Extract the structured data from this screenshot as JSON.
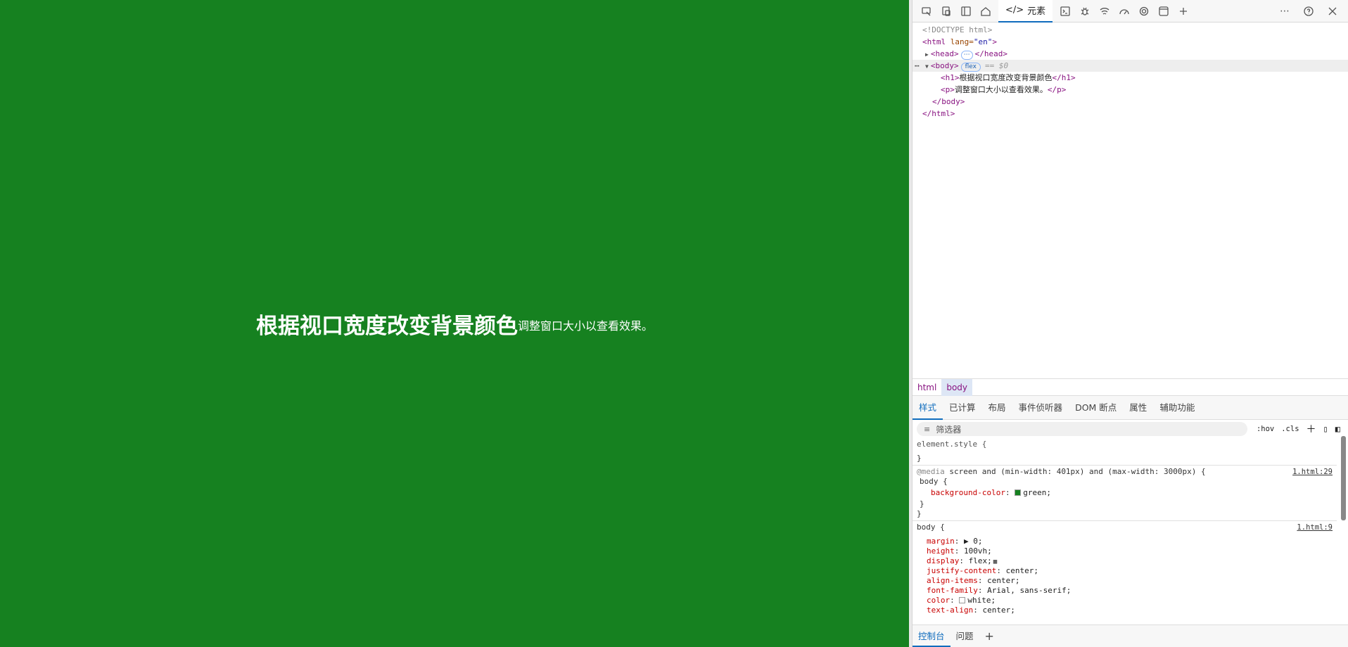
{
  "page": {
    "heading": "根据视口宽度改变背景颜色",
    "paragraph": "调整窗口大小以查看效果。",
    "background": "#168120"
  },
  "devtools": {
    "toolbar": {
      "active_tab": "元素",
      "active_tab_icon": "</>",
      "icons": [
        "inspect-icon",
        "device-icon",
        "dock-icon",
        "home-icon",
        "console-icon",
        "bug-icon",
        "network-icon",
        "performance-icon",
        "settings-gear-icon",
        "application-icon",
        "add-icon"
      ],
      "right_icons": [
        "more-icon",
        "help-icon",
        "close-icon"
      ]
    },
    "dom": {
      "doctype": "<!DOCTYPE html>",
      "html_open": "<html",
      "html_attr": " lang=",
      "html_attr_val": "\"en\"",
      "html_close_bracket": ">",
      "head_open": "<head>",
      "head_ellipsis": "⋯",
      "head_close": "</head>",
      "body_open": "<body>",
      "body_badge": "flex",
      "body_eq": "== $0",
      "h1_open": "<h1>",
      "h1_text": "根据视口宽度改变背景颜色",
      "h1_close": "</h1>",
      "p_open": "<p>",
      "p_text": "调整窗口大小以查看效果。",
      "p_close": "</p>",
      "body_close": "</body>",
      "html_close": "</html>"
    },
    "breadcrumbs": [
      "html",
      "body"
    ],
    "subtabs": [
      "样式",
      "已计算",
      "布局",
      "事件侦听器",
      "DOM 断点",
      "属性",
      "辅助功能"
    ],
    "filter": {
      "placeholder": "筛选器",
      "hov": ":hov",
      "cls": ".cls"
    },
    "styles": {
      "element_style_open": "element.style {",
      "element_style_close": "}",
      "media_at": "@media",
      "media_query": " screen and (min-width: 401px) and (max-width: 3000px) {",
      "media_source": "1.html:29",
      "media_selector": "body {",
      "media_prop": "background-color",
      "media_val": "green;",
      "media_swatch": "#168120",
      "media_inner_close": "}",
      "media_close": "}",
      "body_selector": "body {",
      "body_source": "1.html:9",
      "props": [
        {
          "name": "margin",
          "value": "▶ 0;"
        },
        {
          "name": "height",
          "value": "100vh;"
        },
        {
          "name": "display",
          "value": "flex;"
        },
        {
          "name": "justify-content",
          "value": "center;"
        },
        {
          "name": "align-items",
          "value": "center;"
        },
        {
          "name": "font-family",
          "value": "Arial, sans-serif;"
        },
        {
          "name": "color",
          "value": "white;"
        },
        {
          "name": "text-align",
          "value": "center;"
        }
      ]
    },
    "drawer": [
      "控制台",
      "问题",
      "+"
    ]
  }
}
